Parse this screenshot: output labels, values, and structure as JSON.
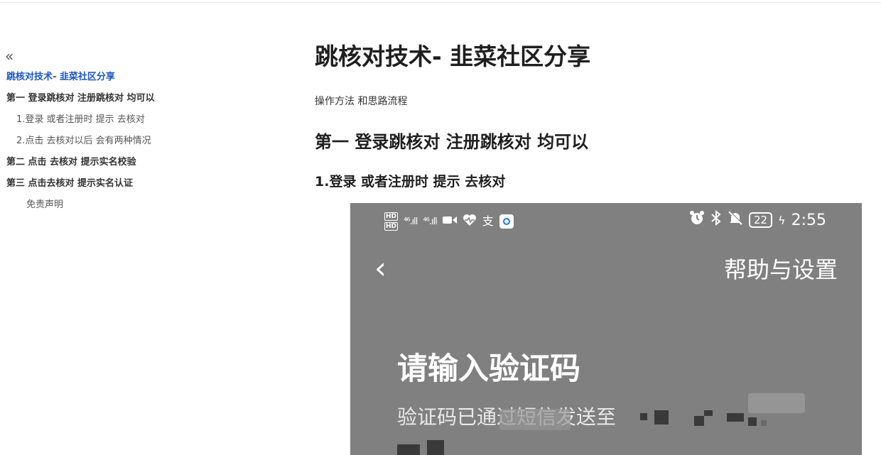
{
  "toc": {
    "collapse_glyph": "«",
    "items": [
      {
        "label": "跳核对技术- 韭菜社区分享",
        "level": 1,
        "active": true
      },
      {
        "label": "第一 登录跳核对 注册跳核对 均可以",
        "level": 1,
        "active": false
      },
      {
        "label": "1.登录 或者注册时 提示 去核对",
        "level": 2,
        "active": false
      },
      {
        "label": "2.点击 去核对以后 会有两种情况",
        "level": 2,
        "active": false
      },
      {
        "label": "第二 点击 去核对 提示实名校验",
        "level": 1,
        "active": false
      },
      {
        "label": "第三 点击去核对 提示实名认证",
        "level": 1,
        "active": false
      },
      {
        "label": "免责声明",
        "level": 3,
        "active": false
      }
    ]
  },
  "article": {
    "title": "跳核对技术- 韭菜社区分享",
    "intro": "操作方法  和思路流程",
    "h2": "第一 登录跳核对  注册跳核对 均可以",
    "h3": "1.登录 或者注册时  提示 去核对"
  },
  "phone": {
    "status": {
      "hd_label": "HD",
      "signal1": "⁴⁶.ıll",
      "signal2": "⁴⁶.ıll",
      "icons_left": [
        "video-icon",
        "heart-icon",
        "alipay-icon",
        "app-icon"
      ],
      "alipay_glyph": "支",
      "icons_right": [
        "alarm-icon",
        "bluetooth-icon",
        "mute-icon"
      ],
      "battery": "22",
      "charging_glyph": "ϟ",
      "time": "2:55"
    },
    "nav": {
      "back_glyph": "‹",
      "help_label": "帮助与设置"
    },
    "otp_title": "请输入验证码",
    "otp_sub": "验证码已通过短信发送至"
  },
  "colors": {
    "toc_active": "#1a55c9",
    "screenshot_bg": "#808080"
  }
}
